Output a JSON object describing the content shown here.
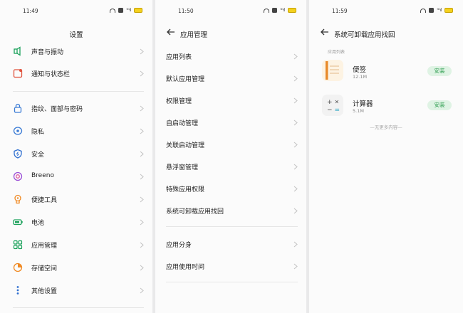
{
  "panel_settings": {
    "time": "11:49",
    "title": "设置",
    "items": [
      {
        "label": "声音与振动",
        "icon": "sound-icon"
      },
      {
        "label": "通知与状态栏",
        "icon": "notification-icon"
      },
      {
        "label": "指纹、面部与密码",
        "icon": "lock-icon"
      },
      {
        "label": "隐私",
        "icon": "privacy-icon"
      },
      {
        "label": "安全",
        "icon": "shield-icon"
      },
      {
        "label": "Breeno",
        "icon": "breeno-icon"
      },
      {
        "label": "便捷工具",
        "icon": "hand-icon"
      },
      {
        "label": "电池",
        "icon": "battery-icon"
      },
      {
        "label": "应用管理",
        "icon": "apps-icon"
      },
      {
        "label": "存储空间",
        "icon": "storage-icon"
      },
      {
        "label": "其他设置",
        "icon": "more-settings-icon"
      }
    ]
  },
  "panel_app_management": {
    "time": "11:50",
    "title": "应用管理",
    "items": [
      {
        "label": "应用列表"
      },
      {
        "label": "默认应用管理"
      },
      {
        "label": "权限管理"
      },
      {
        "label": "自启动管理"
      },
      {
        "label": "关联启动管理"
      },
      {
        "label": "悬浮窗管理"
      },
      {
        "label": "特殊应用权限"
      },
      {
        "label": "系统可卸载应用找回"
      },
      {
        "label": "应用分身"
      },
      {
        "label": "应用使用时间"
      }
    ]
  },
  "panel_restore": {
    "time": "11:59",
    "title": "系统可卸载应用找回",
    "section_label": "应用列表",
    "apps": [
      {
        "name": "便签",
        "size": "12.1M",
        "button": "安装",
        "icon": "notes-app-icon"
      },
      {
        "name": "计算器",
        "size": "5.1M",
        "button": "安装",
        "icon": "calculator-app-icon"
      }
    ],
    "no_more": "—无更多内容—"
  },
  "colors": {
    "accent_green": "#2e9d4f",
    "install_bg": "#dff3e4",
    "background": "#fbfbfb"
  }
}
